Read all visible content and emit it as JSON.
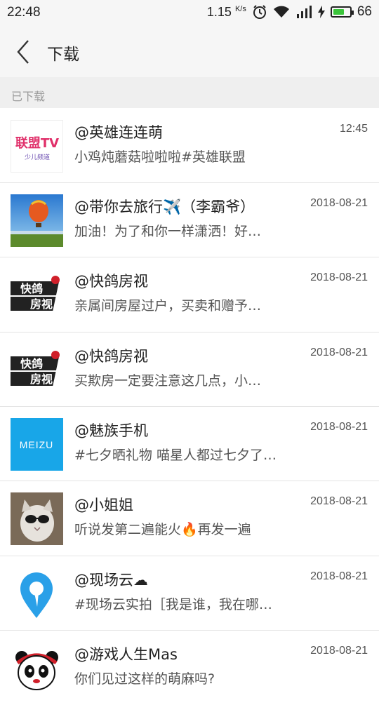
{
  "status_bar": {
    "time": "22:48",
    "speed": "1.15",
    "speed_unit": "K/s",
    "battery": "66",
    "battery_level": 0.66
  },
  "header": {
    "title": "下载"
  },
  "section": {
    "label": "已下载"
  },
  "items": [
    {
      "title": "@英雄连连萌",
      "desc": "小鸡炖蘑菇啦啦啦#英雄联盟",
      "date": "12:45",
      "thumb_icon": "lianmeng-tv-logo",
      "thumb_text1": "联盟TV",
      "thumb_text2": "少儿频道"
    },
    {
      "title": "@带你去旅行✈️（李霸爷）",
      "desc": "加油！为了和你一样潇洒！好…",
      "date": "2018-08-21",
      "thumb_icon": "hot-air-balloon-photo"
    },
    {
      "title": "@快鸽房视",
      "desc": "亲属间房屋过户，买卖和赠予…",
      "date": "2018-08-21",
      "thumb_icon": "kuaige-fangshi-logo",
      "thumb_text1": "快鸽",
      "thumb_text2": "房视"
    },
    {
      "title": "@快鸽房视",
      "desc": "买欺房一定要注意这几点，小…",
      "date": "2018-08-21",
      "thumb_icon": "kuaige-fangshi-logo",
      "thumb_text1": "快鸽",
      "thumb_text2": "房视"
    },
    {
      "title": "@魅族手机",
      "desc": "#七夕晒礼物 喵星人都过七夕了…",
      "date": "2018-08-21",
      "thumb_icon": "meizu-logo",
      "thumb_text1": "MEIZU"
    },
    {
      "title": "@小姐姐",
      "desc": "听说发第二遍能火🔥再发一遍",
      "date": "2018-08-21",
      "thumb_icon": "cat-sunglasses-photo"
    },
    {
      "title": "@现场云☁",
      "desc": "#现场云实拍［我是谁，我在哪…",
      "date": "2018-08-21",
      "thumb_icon": "location-pin-logo"
    },
    {
      "title": "@游戏人生Mas",
      "desc": "你们见过这样的萌麻吗?",
      "date": "2018-08-21",
      "thumb_icon": "panda-avatar"
    }
  ]
}
